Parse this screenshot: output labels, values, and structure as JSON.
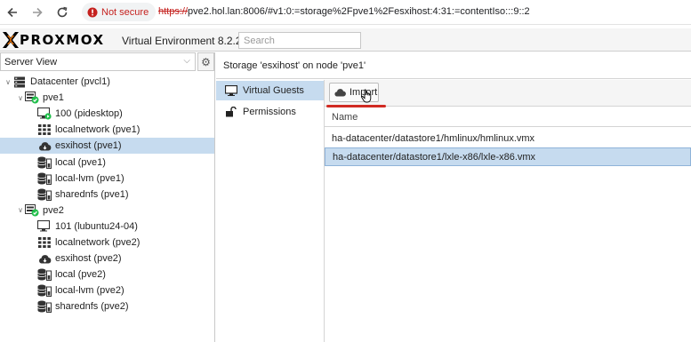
{
  "browser": {
    "security_label": "Not secure",
    "url_scheme": "https://",
    "url_rest": "pve2.hol.lan:8006/#v1:0:=storage%2Fpve1%2Fesxihost:4:31:=contentIso:::9::2"
  },
  "header": {
    "logo_text": "PROXMOX",
    "version": "Virtual Environment 8.2.2",
    "search_placeholder": "Search"
  },
  "sidebar": {
    "view_label": "Server View",
    "tree": [
      {
        "label": "Datacenter (pvcl1)",
        "icon": "datacenter-icon",
        "level": 0,
        "twist": "expanded"
      },
      {
        "label": "pve1",
        "icon": "node-online-icon",
        "level": 1,
        "twist": "expanded"
      },
      {
        "label": "100 (pidesktop)",
        "icon": "vm-running-icon",
        "level": 2
      },
      {
        "label": "localnetwork (pve1)",
        "icon": "network-icon",
        "level": 2
      },
      {
        "label": "esxihost (pve1)",
        "icon": "cloud-storage-icon",
        "level": 2,
        "selected": true
      },
      {
        "label": "local (pve1)",
        "icon": "storage-icon",
        "level": 2
      },
      {
        "label": "local-lvm (pve1)",
        "icon": "storage-icon",
        "level": 2
      },
      {
        "label": "sharednfs (pve1)",
        "icon": "storage-icon",
        "level": 2
      },
      {
        "label": "pve2",
        "icon": "node-online-icon",
        "level": 1,
        "twist": "expanded"
      },
      {
        "label": "101 (lubuntu24-04)",
        "icon": "vm-stopped-icon",
        "level": 2
      },
      {
        "label": "localnetwork (pve2)",
        "icon": "network-icon",
        "level": 2
      },
      {
        "label": "esxihost (pve2)",
        "icon": "cloud-storage-icon",
        "level": 2
      },
      {
        "label": "local (pve2)",
        "icon": "storage-icon",
        "level": 2
      },
      {
        "label": "local-lvm (pve2)",
        "icon": "storage-icon",
        "level": 2
      },
      {
        "label": "sharednfs (pve2)",
        "icon": "storage-icon",
        "level": 2
      }
    ]
  },
  "main": {
    "title": "Storage 'esxihost' on node 'pve1'",
    "nav": [
      {
        "label": "Virtual Guests",
        "icon": "monitor-icon",
        "active": true
      },
      {
        "label": "Permissions",
        "icon": "unlock-icon",
        "active": false
      }
    ],
    "toolbar": {
      "import_label": "Import"
    },
    "column_name": "Name",
    "rows": [
      {
        "name": "ha-datacenter/datastore1/hmlinux/hmlinux.vmx",
        "selected": false
      },
      {
        "name": "ha-datacenter/datastore1/lxle-x86/lxle-x86.vmx",
        "selected": true
      }
    ]
  },
  "colors": {
    "selection": "#c6dbef",
    "accent_red": "#d12a22",
    "online_green": "#21bf4b",
    "logo_orange": "#e57000"
  }
}
